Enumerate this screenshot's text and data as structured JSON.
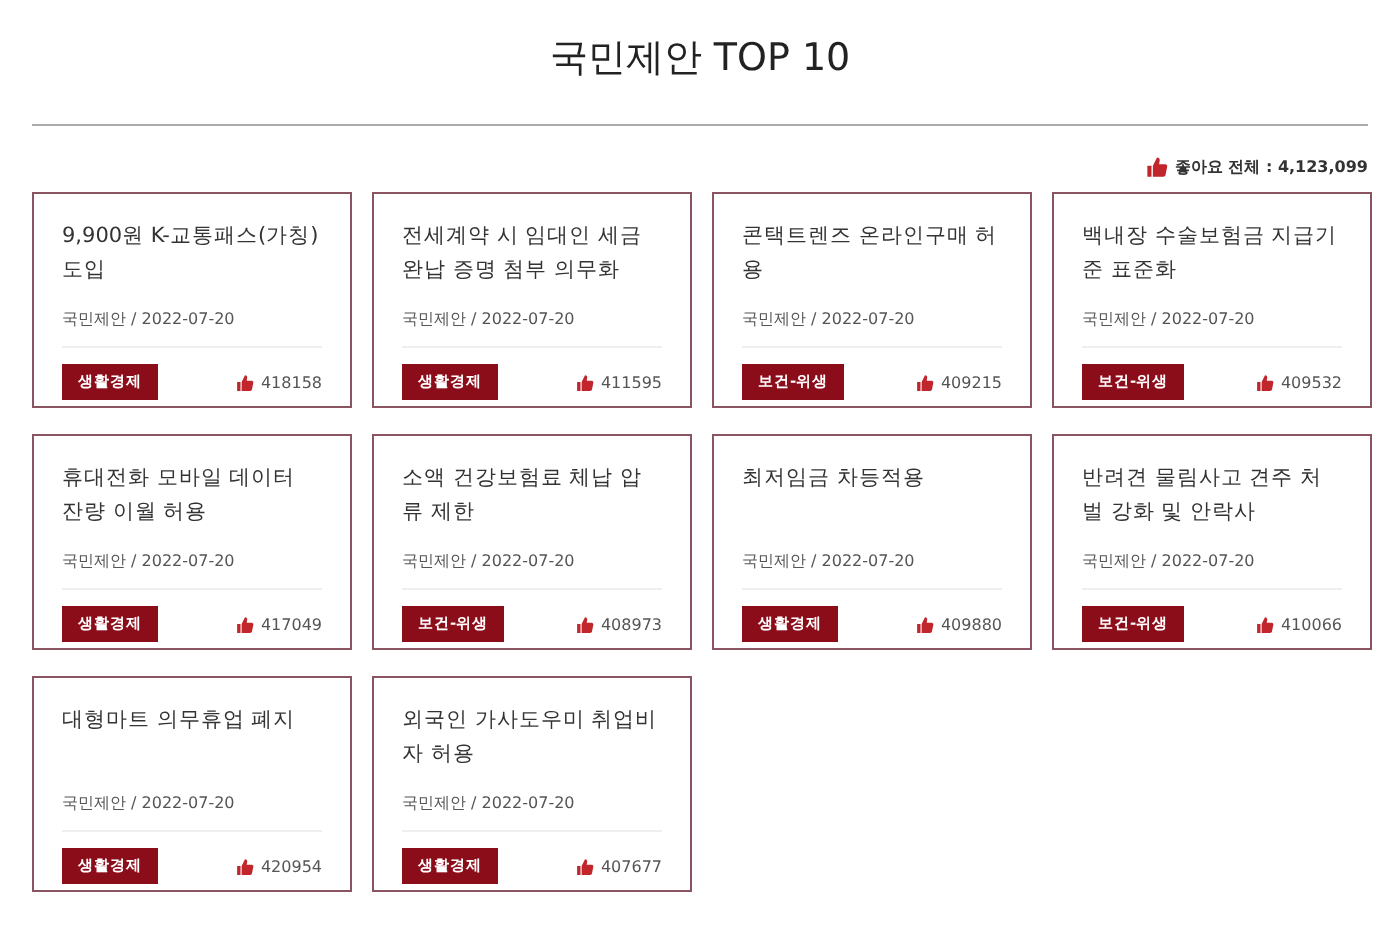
{
  "title": "국민제안 TOP 10",
  "total_likes": {
    "label": "좋아요 전체 : 4,123,099"
  },
  "cards": [
    {
      "title": "9,900원 K-교통패스(가칭) 도입",
      "meta": "국민제안 / 2022-07-20",
      "tag": "생활경제",
      "likes": "418158"
    },
    {
      "title": "전세계약 시 임대인 세금완납 증명 첨부 의무화",
      "meta": "국민제안 / 2022-07-20",
      "tag": "생활경제",
      "likes": "411595"
    },
    {
      "title": "콘택트렌즈 온라인구매 허용",
      "meta": "국민제안 / 2022-07-20",
      "tag": "보건-위생",
      "likes": "409215"
    },
    {
      "title": "백내장 수술보험금 지급기준 표준화",
      "meta": "국민제안 / 2022-07-20",
      "tag": "보건-위생",
      "likes": "409532"
    },
    {
      "title": "휴대전화 모바일 데이터 잔량 이월 허용",
      "meta": "국민제안 / 2022-07-20",
      "tag": "생활경제",
      "likes": "417049"
    },
    {
      "title": "소액 건강보험료 체납 압류 제한",
      "meta": "국민제안 / 2022-07-20",
      "tag": "보건-위생",
      "likes": "408973"
    },
    {
      "title": "최저임금 차등적용",
      "meta": "국민제안 / 2022-07-20",
      "tag": "생활경제",
      "likes": "409880"
    },
    {
      "title": "반려견 물림사고 견주 처벌 강화 및 안락사",
      "meta": "국민제안 / 2022-07-20",
      "tag": "보건-위생",
      "likes": "410066"
    },
    {
      "title": "대형마트 의무휴업 폐지",
      "meta": "국민제안 / 2022-07-20",
      "tag": "생활경제",
      "likes": "420954"
    },
    {
      "title": "외국인 가사도우미 취업비자 허용",
      "meta": "국민제안 / 2022-07-20",
      "tag": "생활경제",
      "likes": "407677"
    }
  ]
}
